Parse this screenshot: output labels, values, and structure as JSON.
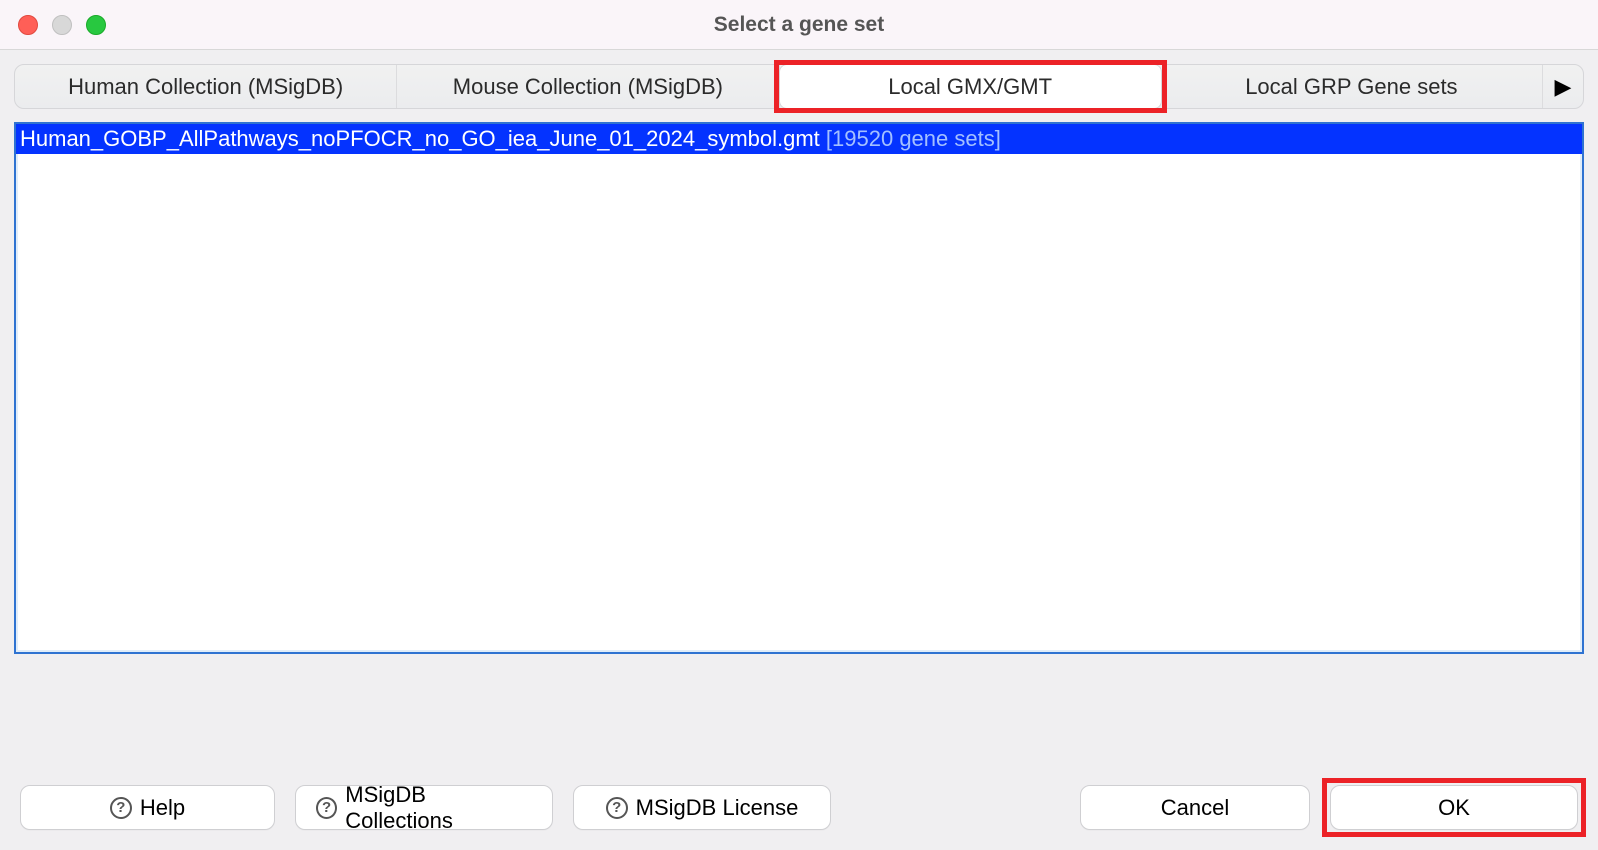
{
  "window": {
    "title": "Select a gene set"
  },
  "tabs": [
    {
      "label": "Human Collection (MSigDB)"
    },
    {
      "label": "Mouse Collection (MSigDB)"
    },
    {
      "label": "Local GMX/GMT"
    },
    {
      "label": "Local GRP Gene sets"
    }
  ],
  "overflow_glyph": "▶",
  "list": {
    "items": [
      {
        "filename": "Human_GOBP_AllPathways_noPFOCR_no_GO_iea_June_01_2024_symbol.gmt",
        "count_label": "[19520 gene sets]"
      }
    ]
  },
  "buttons": {
    "help": "Help",
    "msigdb_collections": "MSigDB Collections",
    "msigdb_license": "MSigDB License",
    "cancel": "Cancel",
    "ok": "OK"
  }
}
